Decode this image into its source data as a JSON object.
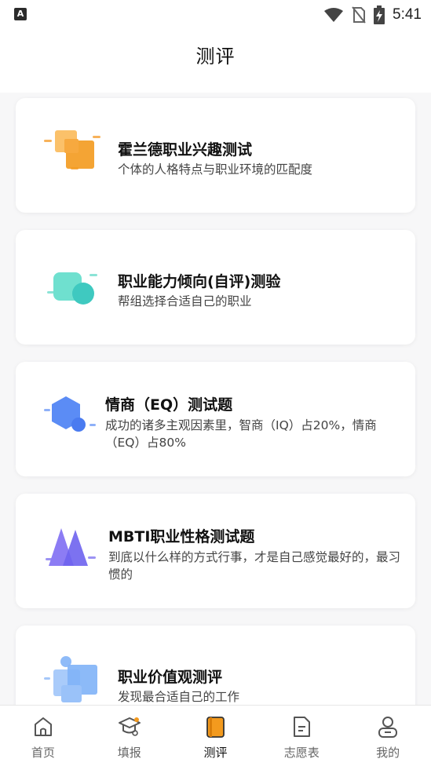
{
  "status_bar": {
    "app_badge": "A",
    "time": "5:41",
    "icons": [
      "wifi-icon",
      "no-sim-icon",
      "battery-charging-icon"
    ]
  },
  "page": {
    "title": "测评"
  },
  "cards": [
    {
      "title": "霍兰德职业兴趣测试",
      "desc": "个体的人格特点与职业环境的匹配度",
      "icon": "orange-squares-icon"
    },
    {
      "title": "职业能力倾向(自评)测验",
      "desc": "帮组选择合适自己的职业",
      "icon": "teal-blocks-icon"
    },
    {
      "title": "情商（EQ）测试题",
      "desc": "成功的诸多主观因素里，智商（IQ）占20%，情商（EQ）占80%",
      "icon": "blue-hexagon-icon"
    },
    {
      "title": "MBTI职业性格测试题",
      "desc": "到底以什么样的方式行事，才是自己感觉最好的，最习惯的",
      "icon": "purple-mountain-icon"
    },
    {
      "title": "职业价值观测评",
      "desc": "发现最合适自己的工作",
      "icon": "blue-puzzle-icon"
    }
  ],
  "tabs": [
    {
      "label": "首页",
      "icon": "home-icon",
      "active": false
    },
    {
      "label": "填报",
      "icon": "graduation-cap-icon",
      "active": false
    },
    {
      "label": "测评",
      "icon": "notebook-icon",
      "active": true
    },
    {
      "label": "志愿表",
      "icon": "document-icon",
      "active": false
    },
    {
      "label": "我的",
      "icon": "profile-icon",
      "active": false
    }
  ],
  "colors": {
    "accent_orange": "#F39A1E",
    "teal": "#5AD9C8",
    "blue": "#5B8CF5",
    "purple": "#7B6CF0",
    "light_blue": "#7FB2F7"
  }
}
